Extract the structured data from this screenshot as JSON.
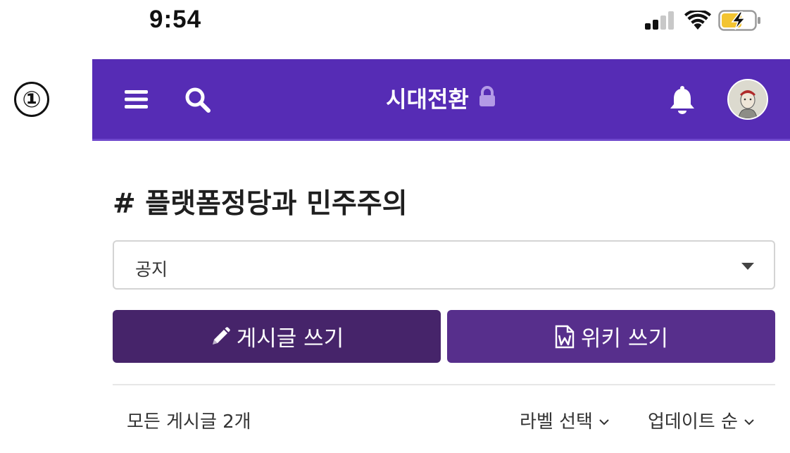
{
  "status_bar": {
    "time": "9:54"
  },
  "step_marker": "①",
  "header": {
    "title": "시대전환",
    "menu_icon": "hamburger-icon",
    "search_icon": "search-icon",
    "lock_icon": "lock-icon",
    "bell_icon": "bell-icon",
    "background_color": "#562cb5"
  },
  "channel": {
    "title": "# 플랫폼정당과 민주주의"
  },
  "category_select": {
    "value": "공지"
  },
  "actions": {
    "write_post_label": "게시글 쓰기",
    "write_post_icon": "pencil-icon",
    "write_wiki_label": "위키 쓰기",
    "write_wiki_icon": "word-document-icon"
  },
  "list_toolbar": {
    "post_count": "모든 게시글 2개",
    "label_filter": "라벨 선택",
    "sort": "업데이트 순"
  }
}
